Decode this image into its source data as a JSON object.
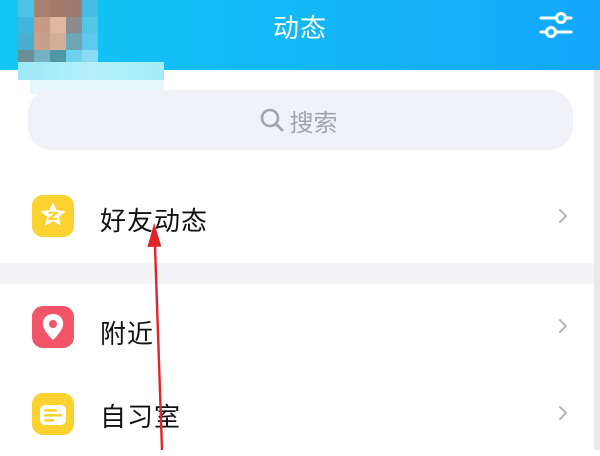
{
  "header": {
    "title": "动态",
    "filter_icon": "filter-sliders-icon"
  },
  "search": {
    "placeholder": "搜索",
    "icon": "search-icon"
  },
  "menu": {
    "items": [
      {
        "label": "好友动态",
        "icon": "qzone-star-icon",
        "icon_color": "#fbd22f"
      },
      {
        "label": "附近",
        "icon": "location-pin-icon",
        "icon_color": "#f2546a"
      },
      {
        "label": "自习室",
        "icon": "study-room-icon",
        "icon_color": "#fbd22f"
      }
    ]
  },
  "colors": {
    "header_start": "#12c7f3",
    "header_end": "#14a7fb",
    "annotation_arrow": "#e0242a"
  }
}
